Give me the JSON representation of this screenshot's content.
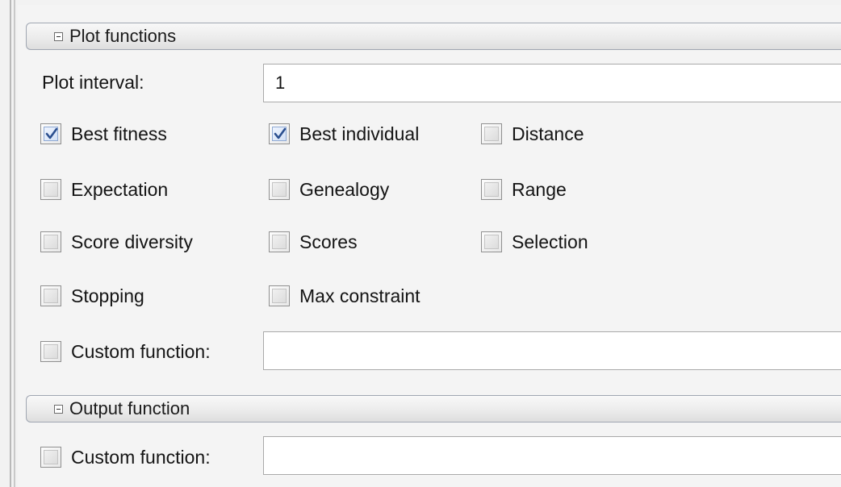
{
  "plot_section": {
    "title": "Plot functions",
    "interval_label": "Plot interval:",
    "interval_value": "1",
    "checkboxes": [
      {
        "label": "Best fitness",
        "checked": true
      },
      {
        "label": "Best individual",
        "checked": true
      },
      {
        "label": "Distance",
        "checked": false
      },
      {
        "label": "Expectation",
        "checked": false
      },
      {
        "label": "Genealogy",
        "checked": false
      },
      {
        "label": "Range",
        "checked": false
      },
      {
        "label": "Score diversity",
        "checked": false
      },
      {
        "label": "Scores",
        "checked": false
      },
      {
        "label": "Selection",
        "checked": false
      },
      {
        "label": "Stopping",
        "checked": false
      },
      {
        "label": "Max constraint",
        "checked": false
      }
    ],
    "custom_function": {
      "label": "Custom function:",
      "checked": false,
      "value": ""
    }
  },
  "output_section": {
    "title": "Output function",
    "custom_function": {
      "label": "Custom function:",
      "checked": false,
      "value": ""
    }
  },
  "colors": {
    "checkmark": "#2b4f8f",
    "header_border": "#9fa6b1"
  }
}
